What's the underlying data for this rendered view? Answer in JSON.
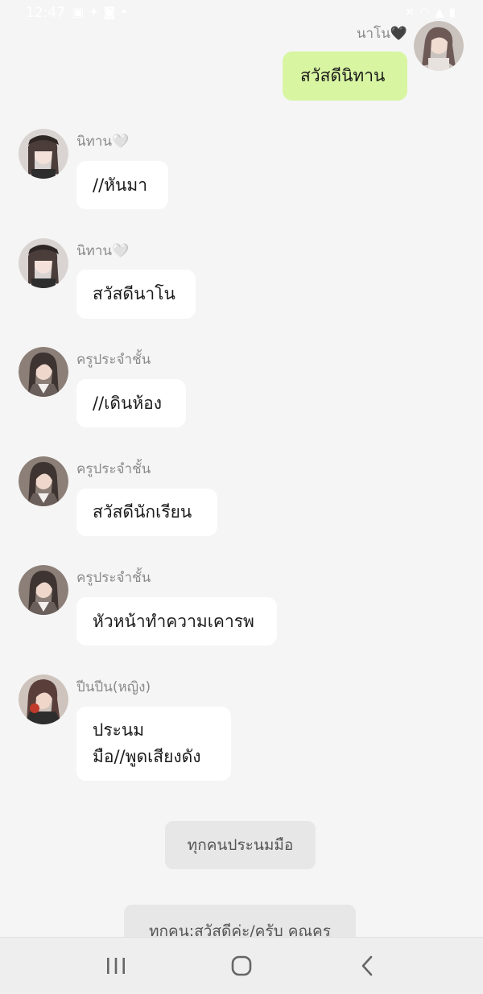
{
  "status_bar": {
    "time": "12:47",
    "left_icons": [
      "gallery-icon",
      "messenger-icon",
      "camera-icon",
      "dot-icon"
    ],
    "right_icons": [
      "mute-icon",
      "wifi-icon",
      "signal-icon",
      "battery-icon"
    ]
  },
  "messages": [
    {
      "sender": "นาโน🖤",
      "text": "สวัสดีนิทาน",
      "mine": true,
      "avatar_color": "#6d5a57"
    },
    {
      "sender": "นิทาน🤍",
      "text": "//หันมา",
      "mine": false,
      "avatar_color": "#4a3d3a"
    },
    {
      "sender": "นิทาน🤍",
      "text": "สวัสดีนาโน",
      "mine": false,
      "avatar_color": "#4a3d3a"
    },
    {
      "sender": "ครูประจำชั้น",
      "text": "//เดินห้อง",
      "mine": false,
      "avatar_color": "#3e3431"
    },
    {
      "sender": "ครูประจำชั้น",
      "text": "สวัสดีนักเรียน",
      "mine": false,
      "avatar_color": "#3e3431"
    },
    {
      "sender": "ครูประจำชั้น",
      "text": "หัวหน้าทำความเคารพ",
      "mine": false,
      "avatar_color": "#3e3431"
    },
    {
      "sender": "ปีนปีน(หญิง)",
      "text_lines": [
        "ประนม",
        "มือ//พูดเสียงดัง"
      ],
      "mine": false,
      "avatar_color": "#5a3e3a"
    }
  ],
  "system_messages": [
    "ทุกคนประนมมือ",
    "ทุกคน:สวัสดีค่ะ/ครับ คุณครู"
  ],
  "nav_bar": {
    "buttons": [
      "recent-apps-icon",
      "home-icon",
      "back-icon"
    ]
  }
}
